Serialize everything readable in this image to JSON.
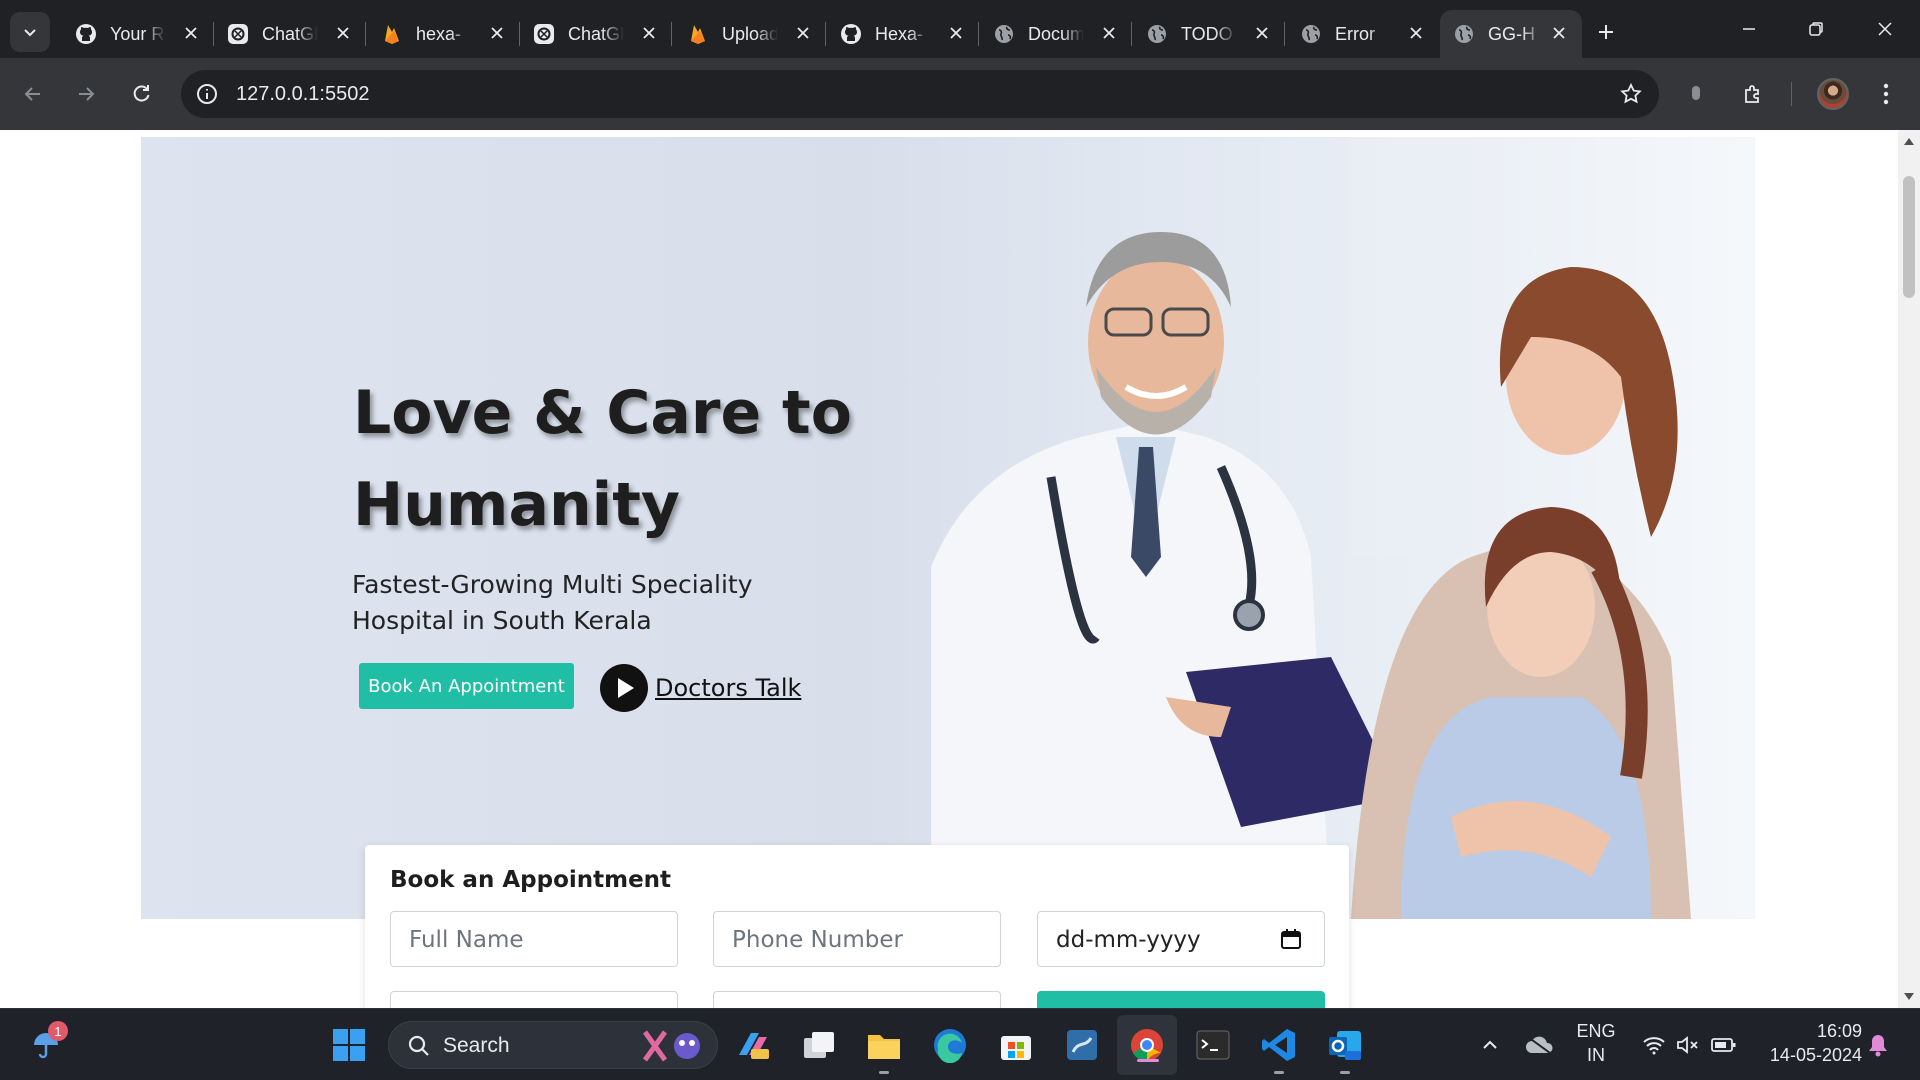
{
  "browser": {
    "tabs": [
      {
        "title": "Your Repositories",
        "favicon": "github-icon",
        "active": false
      },
      {
        "title": "ChatGPT",
        "favicon": "chatgpt-icon",
        "active": false
      },
      {
        "title": "hexa-",
        "favicon": "firebase-icon",
        "active": false
      },
      {
        "title": "ChatGPT",
        "favicon": "chatgpt-icon",
        "active": false
      },
      {
        "title": "Upload",
        "favicon": "firebase-icon",
        "active": false
      },
      {
        "title": "Hexa-",
        "favicon": "github-icon",
        "active": false
      },
      {
        "title": "Document",
        "favicon": "globe-icon",
        "active": false
      },
      {
        "title": "TODO",
        "favicon": "globe-icon",
        "active": false
      },
      {
        "title": "Error",
        "favicon": "globe-icon",
        "active": false
      },
      {
        "title": "GG-H",
        "favicon": "globe-icon",
        "active": true
      }
    ],
    "url": "127.0.0.1:5502"
  },
  "hero": {
    "title": "Love & Care to Humanity",
    "subtitle": "Fastest-Growing Multi Speciality Hospital in South Kerala",
    "book_button": "Book An Appointment",
    "video_link": "Doctors Talk"
  },
  "appointment_form": {
    "title": "Book an Appointment",
    "full_name_placeholder": "Full Name",
    "phone_placeholder": "Phone Number",
    "date_value": "dd-mm-yyyy",
    "accent_color": "#20bfa5"
  },
  "taskbar": {
    "search_label": "Search",
    "weather_badge": "1",
    "language_line1": "ENG",
    "language_line2": "IN",
    "time": "16:09",
    "date": "14-05-2024"
  }
}
